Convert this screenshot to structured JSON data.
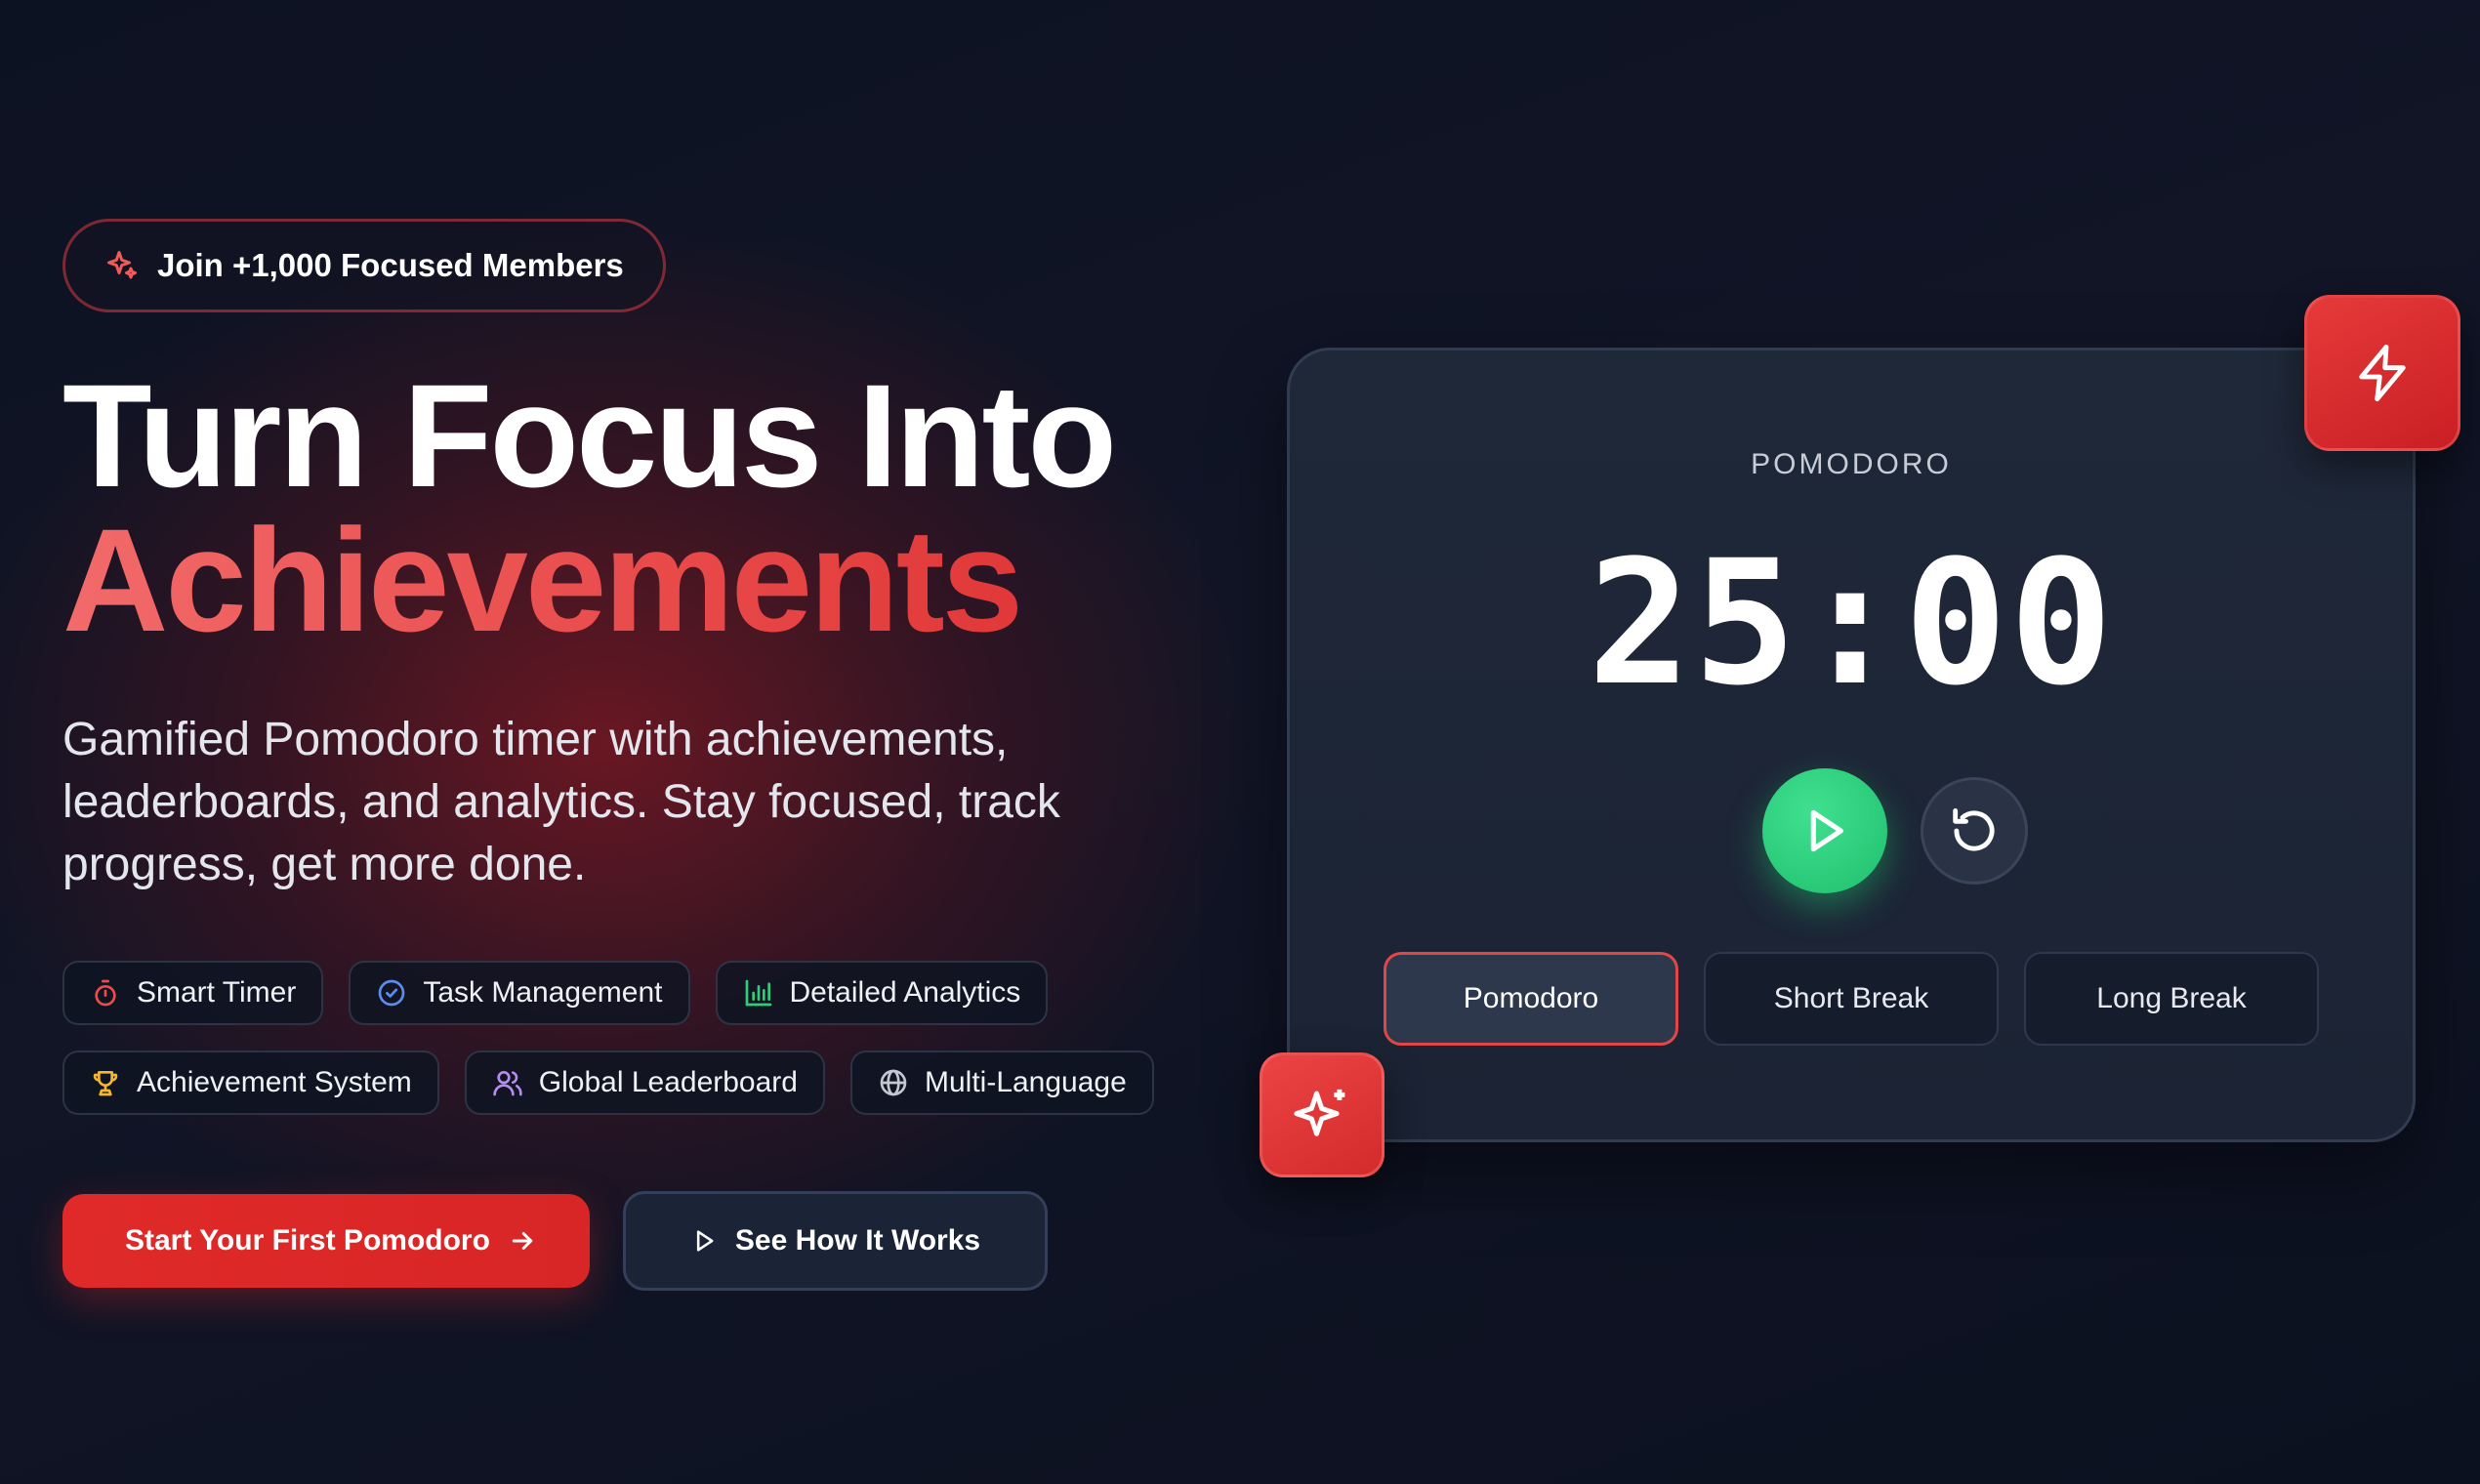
{
  "badge": {
    "icon": "sparkles-icon",
    "label": "Join +1,000 Focused Members"
  },
  "headline": {
    "line1": "Turn Focus Into",
    "line2": "Achievements"
  },
  "subtitle": "Gamified Pomodoro timer with achievements, leaderboards, and analytics. Stay focused, track progress, get more done.",
  "features": [
    {
      "icon": "timer-icon",
      "label": "Smart Timer",
      "color": "#ef4a4a"
    },
    {
      "icon": "check-circle-icon",
      "label": "Task Management",
      "color": "#5b8def"
    },
    {
      "icon": "bar-chart-icon",
      "label": "Detailed Analytics",
      "color": "#2fcf7a"
    },
    {
      "icon": "trophy-icon",
      "label": "Achievement System",
      "color": "#f5b731"
    },
    {
      "icon": "users-icon",
      "label": "Global Leaderboard",
      "color": "#b58cf0"
    },
    {
      "icon": "globe-icon",
      "label": "Multi-Language",
      "color": "#c3c7d2"
    }
  ],
  "cta": {
    "primary": "Start Your First Pomodoro",
    "secondary": "See How It Works"
  },
  "timer": {
    "label": "POMODORO",
    "value": "25:00",
    "modes": [
      "Pomodoro",
      "Short Break",
      "Long Break"
    ],
    "active_mode": "Pomodoro"
  },
  "colors": {
    "accent": "#e02a2a",
    "play": "#22c870",
    "background": "#0d1222"
  }
}
